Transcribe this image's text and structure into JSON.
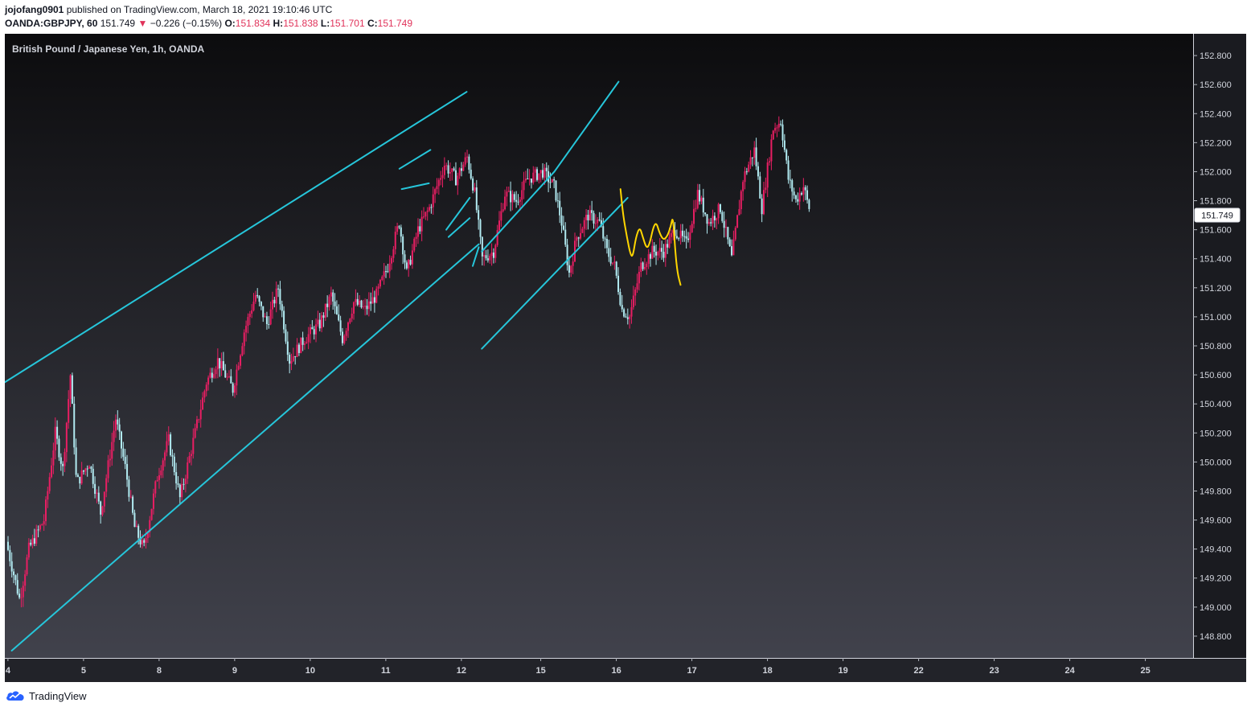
{
  "header": {
    "author": "jojofang0901",
    "published_text": "published on TradingView.com, March 18, 2021 19:10:46 UTC",
    "symbol": "OANDA:GBPJPY, 60",
    "last_price": "151.749",
    "change_arrow": "▼",
    "change": "−0.226 (−0.15%)",
    "open_label": "O:",
    "open_value": "151.834",
    "high_label": "H:",
    "high_value": "151.838",
    "low_label": "L:",
    "low_value": "151.701",
    "close_label": "C:",
    "close_value": "151.749"
  },
  "footer": {
    "brand": "TradingView"
  },
  "chart_data": {
    "type": "candlestick",
    "title": "British Pound / Japanese Yen, 1h, OANDA",
    "ylim": [
      148.65,
      152.95
    ],
    "y_ticks": [
      "148.800",
      "149.000",
      "149.200",
      "149.400",
      "149.600",
      "149.800",
      "150.000",
      "150.200",
      "150.400",
      "150.600",
      "150.800",
      "151.000",
      "151.200",
      "151.400",
      "151.600",
      "151.800",
      "152.000",
      "152.200",
      "152.400",
      "152.600",
      "152.800"
    ],
    "x_ticks": [
      "4",
      "5",
      "8",
      "9",
      "10",
      "11",
      "12",
      "15",
      "16",
      "17",
      "18",
      "19",
      "22",
      "23",
      "24",
      "25"
    ],
    "last_price_label": "151.749",
    "colors": {
      "up": "#e91e63",
      "down": "#b2ebf2",
      "trendline": "#26c6da",
      "projection": "#ffd600",
      "price_tag_bg": "#ffffff",
      "price_tag_text": "#131722"
    },
    "anchors": [
      {
        "t": 0,
        "p": 149.45
      },
      {
        "t": 1.8,
        "p": 149.05
      },
      {
        "t": 3,
        "p": 149.4
      },
      {
        "t": 5,
        "p": 149.6
      },
      {
        "t": 6.5,
        "p": 150.2
      },
      {
        "t": 7.5,
        "p": 149.95
      },
      {
        "t": 8.5,
        "p": 150.6
      },
      {
        "t": 9.3,
        "p": 149.85
      },
      {
        "t": 11,
        "p": 150.0
      },
      {
        "t": 12.5,
        "p": 149.65
      },
      {
        "t": 14.5,
        "p": 150.3
      },
      {
        "t": 15.8,
        "p": 149.95
      },
      {
        "t": 17,
        "p": 149.55
      },
      {
        "t": 18.2,
        "p": 149.4
      },
      {
        "t": 20,
        "p": 149.9
      },
      {
        "t": 21.5,
        "p": 150.15
      },
      {
        "t": 23,
        "p": 149.75
      },
      {
        "t": 25,
        "p": 150.2
      },
      {
        "t": 26.5,
        "p": 150.55
      },
      {
        "t": 28,
        "p": 150.7
      },
      {
        "t": 30,
        "p": 150.5
      },
      {
        "t": 31.5,
        "p": 150.9
      },
      {
        "t": 33,
        "p": 151.15
      },
      {
        "t": 34.5,
        "p": 150.95
      },
      {
        "t": 36,
        "p": 151.2
      },
      {
        "t": 37.5,
        "p": 150.7
      },
      {
        "t": 39.5,
        "p": 150.85
      },
      {
        "t": 41.5,
        "p": 150.95
      },
      {
        "t": 43,
        "p": 151.15
      },
      {
        "t": 44.5,
        "p": 150.85
      },
      {
        "t": 46,
        "p": 151.1
      },
      {
        "t": 47.5,
        "p": 151.05
      },
      {
        "t": 49,
        "p": 151.15
      },
      {
        "t": 50.5,
        "p": 151.35
      },
      {
        "t": 52,
        "p": 151.65
      },
      {
        "t": 53,
        "p": 151.3
      },
      {
        "t": 54.5,
        "p": 151.6
      },
      {
        "t": 56,
        "p": 151.75
      },
      {
        "t": 58,
        "p": 152.05
      },
      {
        "t": 59.5,
        "p": 151.95
      },
      {
        "t": 61,
        "p": 152.1
      },
      {
        "t": 62,
        "p": 151.85
      },
      {
        "t": 63,
        "p": 151.4
      },
      {
        "t": 64.5,
        "p": 151.45
      },
      {
        "t": 66,
        "p": 151.85
      },
      {
        "t": 67.5,
        "p": 151.8
      },
      {
        "t": 69,
        "p": 151.95
      },
      {
        "t": 71,
        "p": 152.0
      },
      {
        "t": 72.5,
        "p": 151.9
      },
      {
        "t": 73.5,
        "p": 151.65
      },
      {
        "t": 74.5,
        "p": 151.3
      },
      {
        "t": 75.5,
        "p": 151.55
      },
      {
        "t": 77,
        "p": 151.7
      },
      {
        "t": 78.5,
        "p": 151.65
      },
      {
        "t": 79.5,
        "p": 151.45
      },
      {
        "t": 80.5,
        "p": 151.35
      },
      {
        "t": 81.5,
        "p": 151.05
      },
      {
        "t": 82.5,
        "p": 151.0
      },
      {
        "t": 84,
        "p": 151.35
      },
      {
        "t": 85.5,
        "p": 151.45
      },
      {
        "t": 87,
        "p": 151.45
      },
      {
        "t": 88.5,
        "p": 151.6
      },
      {
        "t": 90,
        "p": 151.5
      },
      {
        "t": 91.5,
        "p": 151.85
      },
      {
        "t": 93,
        "p": 151.65
      },
      {
        "t": 94.5,
        "p": 151.75
      },
      {
        "t": 96,
        "p": 151.4
      },
      {
        "t": 97.5,
        "p": 151.95
      },
      {
        "t": 99,
        "p": 152.15
      },
      {
        "t": 100,
        "p": 151.75
      },
      {
        "t": 101.5,
        "p": 152.3
      },
      {
        "t": 102.5,
        "p": 152.35
      },
      {
        "t": 103.5,
        "p": 151.95
      },
      {
        "t": 104.5,
        "p": 151.8
      },
      {
        "t": 105.5,
        "p": 151.9
      },
      {
        "t": 106.2,
        "p": 151.75
      }
    ],
    "trendlines": [
      {
        "from": {
          "t": -0.2,
          "p": 150.55
        },
        "to": {
          "t": 60.9,
          "p": 152.55
        }
      },
      {
        "from": {
          "t": 0.7,
          "p": 148.7
        },
        "to": {
          "t": 62.5,
          "p": 151.5
        }
      },
      {
        "from": {
          "t": 52,
          "p": 152.02
        },
        "to": {
          "t": 56.1,
          "p": 152.15
        }
      },
      {
        "from": {
          "t": 52.3,
          "p": 151.88
        },
        "to": {
          "t": 55.9,
          "p": 151.92
        }
      },
      {
        "from": {
          "t": 58.2,
          "p": 151.6
        },
        "to": {
          "t": 61.3,
          "p": 151.82
        }
      },
      {
        "from": {
          "t": 58.5,
          "p": 151.55
        },
        "to": {
          "t": 61.3,
          "p": 151.68
        }
      },
      {
        "from": {
          "t": 61.7,
          "p": 151.35
        },
        "to": {
          "t": 62.5,
          "p": 151.48
        }
      },
      {
        "from": {
          "t": 62.9,
          "p": 151.45
        },
        "to": {
          "t": 72.5,
          "p": 152.0
        }
      },
      {
        "from": {
          "t": 62.9,
          "p": 150.78
        },
        "to": {
          "t": 82.2,
          "p": 151.82
        }
      },
      {
        "from": {
          "t": 72.5,
          "p": 152.0
        },
        "to": {
          "t": 81.0,
          "p": 152.62
        }
      }
    ],
    "projection": [
      {
        "t": 81.25,
        "p": 151.88
      },
      {
        "t": 81.6,
        "p": 151.7
      },
      {
        "t": 82.1,
        "p": 151.55
      },
      {
        "t": 82.6,
        "p": 151.42
      },
      {
        "t": 82.9,
        "p": 151.42
      },
      {
        "t": 83.3,
        "p": 151.55
      },
      {
        "t": 83.8,
        "p": 151.62
      },
      {
        "t": 84.2,
        "p": 151.55
      },
      {
        "t": 84.7,
        "p": 151.47
      },
      {
        "t": 85.1,
        "p": 151.5
      },
      {
        "t": 85.6,
        "p": 151.62
      },
      {
        "t": 86.0,
        "p": 151.65
      },
      {
        "t": 86.4,
        "p": 151.58
      },
      {
        "t": 86.9,
        "p": 151.53
      },
      {
        "t": 87.4,
        "p": 151.55
      },
      {
        "t": 87.9,
        "p": 151.62
      },
      {
        "t": 88.2,
        "p": 151.7
      },
      {
        "t": 88.5,
        "p": 151.45
      },
      {
        "t": 88.8,
        "p": 151.3
      },
      {
        "t": 89.2,
        "p": 151.22
      }
    ]
  }
}
